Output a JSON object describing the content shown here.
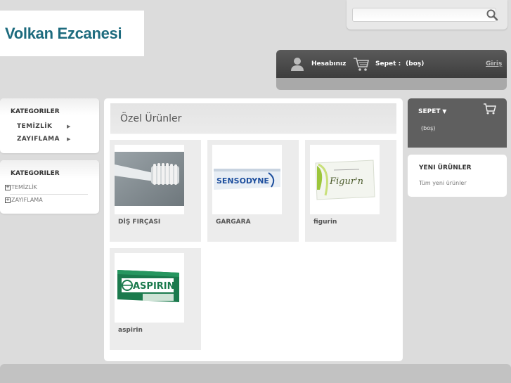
{
  "header": {
    "logo_text": "Volkan Ezcanesi",
    "search": {
      "value": "",
      "placeholder": ""
    }
  },
  "account_bar": {
    "account_label": "Hesabınız",
    "cart_label": "Sepet :",
    "cart_status": "(boş)",
    "login_label": "Giriş"
  },
  "sidebar": {
    "menu_block": {
      "title": "KATEGORILER",
      "items": [
        "TEMİZLİK",
        "ZAYIFLAMA"
      ]
    },
    "tree_block": {
      "title": "KATEGORILER",
      "items": [
        "TEMİZLİK",
        "ZAYIFLAMA"
      ]
    }
  },
  "main": {
    "title": "Özel Ürünler",
    "products": [
      {
        "name": "DİŞ FIRÇASI",
        "image": "toothbrush"
      },
      {
        "name": "GARGARA",
        "image": "sensodyne-box"
      },
      {
        "name": "figurin",
        "image": "figurin-box"
      },
      {
        "name": "aspirin",
        "image": "aspirin-box"
      }
    ]
  },
  "cart_panel": {
    "title": "SEPET",
    "status": "(boş)"
  },
  "new_products": {
    "title": "YENI ÜRÜNLER",
    "link": "Tüm yeni ürünler"
  },
  "colors": {
    "background": "#dcdcdc",
    "logo_text": "#1d6b7e",
    "dark_bar": "#4a4a4a",
    "product_card": "#ececec"
  }
}
